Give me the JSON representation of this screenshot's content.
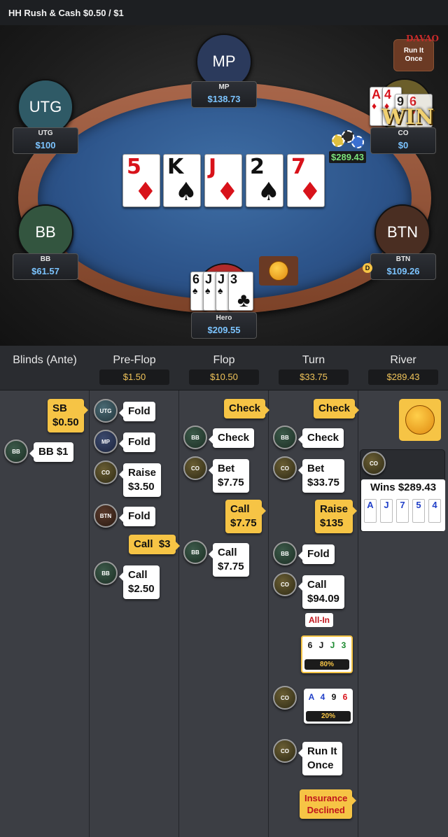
{
  "header": {
    "title": "HH  Rush & Cash $0.50 / $1"
  },
  "table": {
    "players": {
      "mp": {
        "avatar": "MP",
        "name": "MP",
        "stack": "$138.73",
        "color": "#2b3a5c"
      },
      "utg": {
        "avatar": "UTG",
        "name": "UTG",
        "stack": "$100",
        "color": "#2f5a66"
      },
      "co": {
        "name": "CO",
        "stack": "$0",
        "win_label": "WIN",
        "cards": [
          {
            "rank": "A",
            "suit": "♦"
          },
          {
            "rank": "4",
            "suit": "♦"
          },
          {
            "rank": "9",
            "suit": "♠"
          },
          {
            "rank": "6",
            "suit": "♥"
          }
        ]
      },
      "bb": {
        "avatar": "BB",
        "name": "BB",
        "stack": "$61.57",
        "color": "#33553f"
      },
      "btn": {
        "avatar": "BTN",
        "name": "BTN",
        "stack": "$109.26",
        "color": "#4a2e22"
      },
      "hero": {
        "name": "Hero",
        "stack": "$209.55",
        "cards": [
          {
            "rank": "6",
            "suit": "♠"
          },
          {
            "rank": "J",
            "suit": "♠"
          },
          {
            "rank": "J",
            "suit": "♠"
          },
          {
            "rank": "3",
            "suit": "♣"
          }
        ]
      }
    },
    "pot": "$289.43",
    "run_it_once": "Run It\nOnce",
    "logo": "DAVAO",
    "dealer_button": "D",
    "board": [
      {
        "rank": "5",
        "suit": "♦",
        "color": "red"
      },
      {
        "rank": "K",
        "suit": "♠",
        "color": "blk"
      },
      {
        "rank": "J",
        "suit": "♦",
        "color": "red"
      },
      {
        "rank": "2",
        "suit": "♠",
        "color": "blk"
      },
      {
        "rank": "7",
        "suit": "♦",
        "color": "red"
      }
    ]
  },
  "history": {
    "columns": [
      {
        "title": "Blinds (Ante)",
        "pot": ""
      },
      {
        "title": "Pre-Flop",
        "pot": "$1.50"
      },
      {
        "title": "Flop",
        "pot": "$10.50"
      },
      {
        "title": "Turn",
        "pot": "$33.75"
      },
      {
        "title": "River",
        "pot": "$289.43"
      }
    ],
    "blinds": {
      "sb": "SB\n$0.50",
      "bb_chip": "BB",
      "bb": "BB $1"
    },
    "preflop": {
      "utg": {
        "chip": "UTG",
        "action": "Fold"
      },
      "mp": {
        "chip": "MP",
        "action": "Fold"
      },
      "co": {
        "chip": "CO",
        "action": "Raise\n$3.50"
      },
      "btn": {
        "chip": "BTN",
        "action": "Fold"
      },
      "hero": {
        "action": "Call  $3"
      },
      "bb": {
        "chip": "BB",
        "action": "Call\n$2.50"
      }
    },
    "flop": {
      "hero_check": "Check",
      "bb": {
        "chip": "BB",
        "action": "Check"
      },
      "co": {
        "chip": "CO",
        "action": "Bet\n$7.75"
      },
      "hero_call": "Call\n$7.75",
      "bb2": {
        "chip": "BB",
        "action": "Call\n$7.75"
      }
    },
    "turn": {
      "hero_check": "Check",
      "bb": {
        "chip": "BB",
        "action": "Check"
      },
      "co": {
        "chip": "CO",
        "action": "Bet\n$33.75"
      },
      "hero_raise": "Raise\n$135",
      "bb2": {
        "chip": "BB",
        "action": "Fold"
      },
      "co2": {
        "chip": "CO",
        "action": "Call\n$94.09"
      },
      "all_in": "All-In",
      "hero_equity": {
        "cards": [
          {
            "r": "6",
            "s": "♠"
          },
          {
            "r": "J",
            "s": "♠"
          },
          {
            "r": "J",
            "s": "♣"
          },
          {
            "r": "3",
            "s": "♣"
          }
        ],
        "pct": "80%"
      },
      "co_equity": {
        "chip": "CO",
        "cards": [
          {
            "r": "A",
            "s": "♦"
          },
          {
            "r": "4",
            "s": "♦"
          },
          {
            "r": "9",
            "s": "♠"
          },
          {
            "r": "6",
            "s": "♥"
          }
        ],
        "pct": "20%"
      },
      "co_run": {
        "chip": "CO",
        "action": "Run It\nOnce"
      },
      "insurance": "Insurance\nDeclined"
    },
    "river": {
      "co_chip": "CO",
      "wins": "Wins $289.43",
      "hand": [
        {
          "r": "A",
          "s": "♦"
        },
        {
          "r": "J",
          "s": "♦"
        },
        {
          "r": "7",
          "s": "♦"
        },
        {
          "r": "5",
          "s": "♦"
        },
        {
          "r": "4",
          "s": "♦"
        }
      ]
    }
  }
}
